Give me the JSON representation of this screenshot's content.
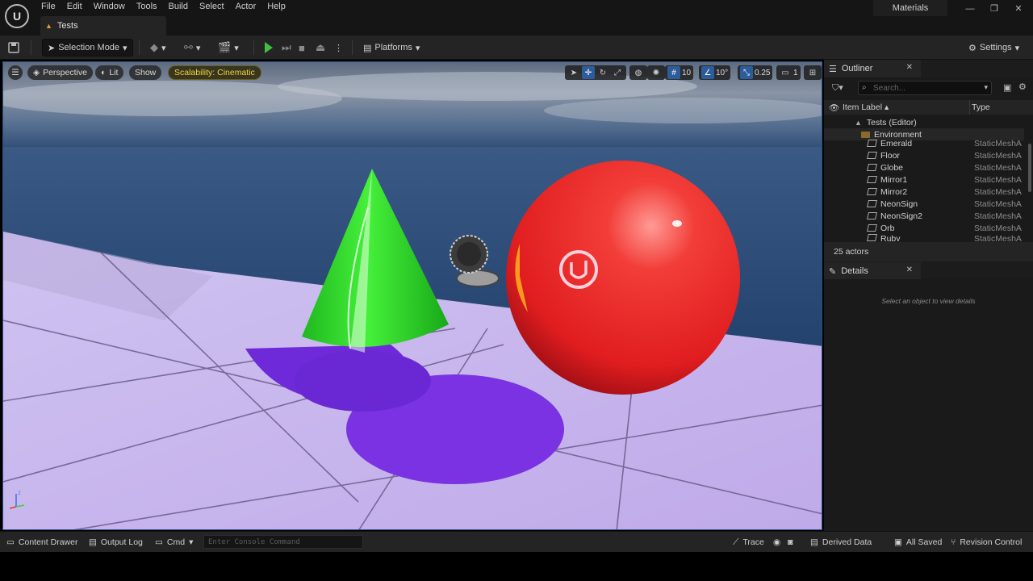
{
  "app": {
    "menu": [
      "File",
      "Edit",
      "Window",
      "Tools",
      "Build",
      "Select",
      "Actor",
      "Help"
    ],
    "tab_title": "Tests",
    "top_right_label": "Materials"
  },
  "toolbar": {
    "selection_mode": "Selection Mode",
    "platforms": "Platforms",
    "settings": "Settings"
  },
  "viewport": {
    "perspective": "Perspective",
    "lit": "Lit",
    "show": "Show",
    "scalability": "Scalability: Cinematic",
    "grid_size": "10",
    "rotation_snap": "10°",
    "scale_snap": "0.25",
    "camera_speed": "1"
  },
  "outliner": {
    "tab_label": "Outliner",
    "search_placeholder": "Search...",
    "col_item_label": "Item Label",
    "col_type": "Type",
    "tree": [
      {
        "label": "Tests (Editor)",
        "type": "",
        "kind": "world"
      },
      {
        "label": "Environment",
        "type": "",
        "kind": "folder"
      },
      {
        "label": "Emerald",
        "type": "StaticMeshA",
        "kind": "mesh"
      },
      {
        "label": "Floor",
        "type": "StaticMeshA",
        "kind": "mesh"
      },
      {
        "label": "Globe",
        "type": "StaticMeshA",
        "kind": "mesh"
      },
      {
        "label": "Mirror1",
        "type": "StaticMeshA",
        "kind": "mesh"
      },
      {
        "label": "Mirror2",
        "type": "StaticMeshA",
        "kind": "mesh"
      },
      {
        "label": "NeonSign",
        "type": "StaticMeshA",
        "kind": "mesh"
      },
      {
        "label": "NeonSign2",
        "type": "StaticMeshA",
        "kind": "mesh"
      },
      {
        "label": "Orb",
        "type": "StaticMeshA",
        "kind": "mesh"
      },
      {
        "label": "Ruby",
        "type": "StaticMeshA",
        "kind": "mesh"
      }
    ],
    "actor_count": "25 actors"
  },
  "details": {
    "tab_label": "Details",
    "empty_message": "Select an object to view details"
  },
  "statusbar": {
    "content_drawer": "Content Drawer",
    "output_log": "Output Log",
    "cmd": "Cmd",
    "console_placeholder": "Enter Console Command",
    "trace": "Trace",
    "derived_data": "Derived Data",
    "all_saved": "All Saved",
    "revision_control": "Revision Control"
  },
  "colors": {
    "cone": "#2ee02a",
    "sphere": "#f0302c",
    "floor": "#c8b6ee",
    "shadow": "#7a2fe0",
    "accent": "#2d5c9a"
  }
}
